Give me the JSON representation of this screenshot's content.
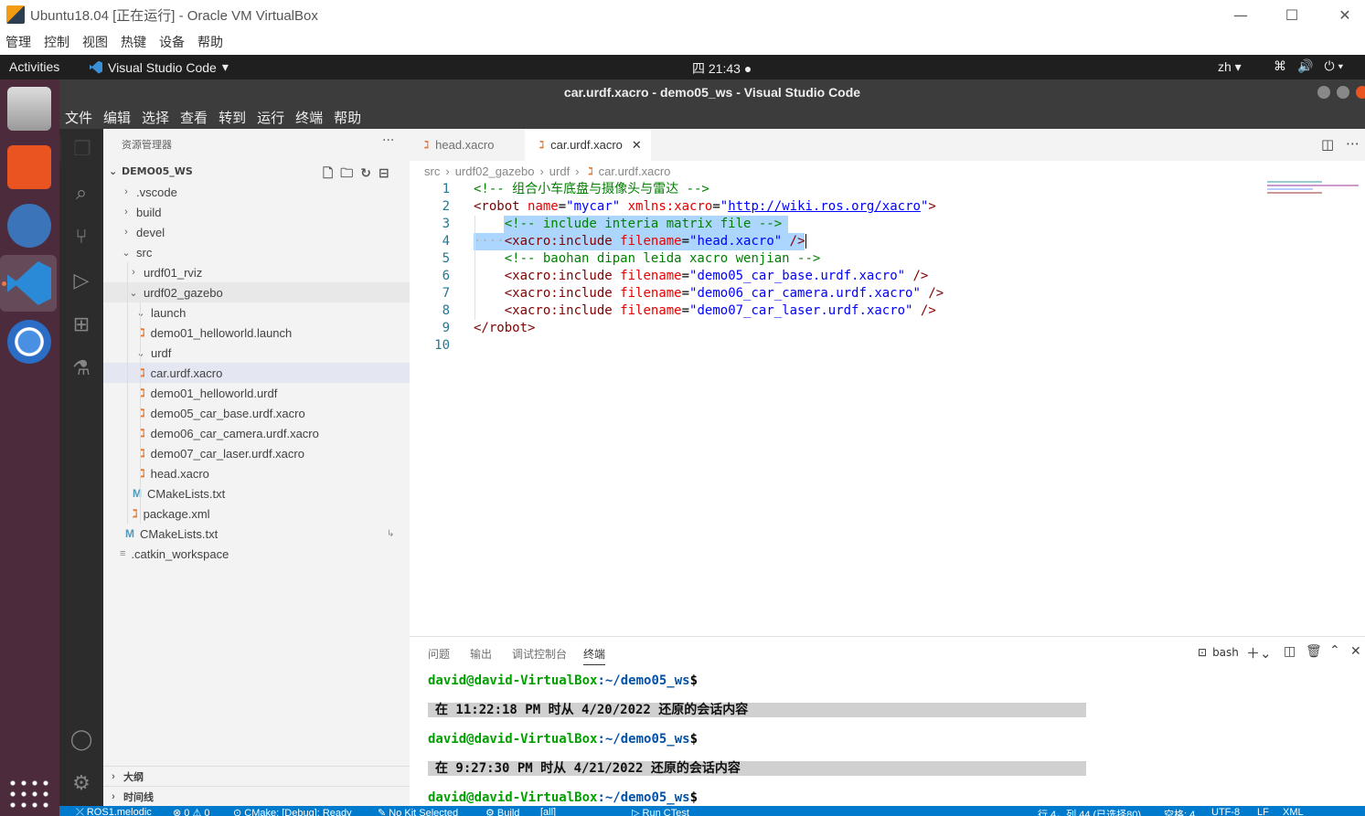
{
  "vbox": {
    "title": "Ubuntu18.04 [正在运行] - Oracle VM VirtualBox",
    "menu": [
      "管理",
      "控制",
      "视图",
      "热键",
      "设备",
      "帮助"
    ],
    "controls": {
      "minimize": "—",
      "maximize": "☐",
      "close": "✕"
    }
  },
  "ubuntu": {
    "activities": "Activities",
    "app_name": "Visual Studio Code",
    "app_arrow": "▾",
    "clock": "四 21:43 ●",
    "lang": "zh ▾",
    "tray": [
      "⌘",
      "🔊",
      "⏻ ▾"
    ]
  },
  "vscode": {
    "title": "car.urdf.xacro - demo05_ws - Visual Studio Code",
    "menu": [
      "文件",
      "编辑",
      "选择",
      "查看",
      "转到",
      "运行",
      "终端",
      "帮助"
    ],
    "explorer_title": "资源管理器",
    "explorer_dots": "···",
    "workspace": "DEMO05_WS",
    "tree": [
      {
        "label": ".vscode",
        "chev": "›",
        "icon": ""
      },
      {
        "label": "build",
        "chev": "›",
        "icon": ""
      },
      {
        "label": "devel",
        "chev": "›",
        "icon": ""
      },
      {
        "label": "src",
        "chev": "⌄",
        "icon": ""
      },
      {
        "label": "urdf01_rviz",
        "chev": "›",
        "icon": ""
      },
      {
        "label": "urdf02_gazebo",
        "chev": "⌄",
        "icon": ""
      },
      {
        "label": "launch",
        "chev": "⌄",
        "icon": ""
      },
      {
        "label": "demo01_helloworld.launch",
        "chev": "",
        "icon": "x"
      },
      {
        "label": "urdf",
        "chev": "⌄",
        "icon": ""
      },
      {
        "label": "car.urdf.xacro",
        "chev": "",
        "icon": "x"
      },
      {
        "label": "demo01_helloworld.urdf",
        "chev": "",
        "icon": "x"
      },
      {
        "label": "demo05_car_base.urdf.xacro",
        "chev": "",
        "icon": "x"
      },
      {
        "label": "demo06_car_camera.urdf.xacro",
        "chev": "",
        "icon": "x"
      },
      {
        "label": "demo07_car_laser.urdf.xacro",
        "chev": "",
        "icon": "x"
      },
      {
        "label": "head.xacro",
        "chev": "",
        "icon": "x"
      },
      {
        "label": "CMakeLists.txt",
        "chev": "",
        "icon": "M"
      },
      {
        "label": "package.xml",
        "chev": "",
        "icon": "x"
      },
      {
        "label": "CMakeLists.txt",
        "chev": "",
        "icon": "M"
      },
      {
        "label": ".catkin_workspace",
        "chev": "",
        "icon": "≡"
      }
    ],
    "outline": "大纲",
    "timeline": "时间线",
    "tabs": [
      {
        "label": "head.xacro"
      },
      {
        "label": "car.urdf.xacro",
        "close": "✕"
      }
    ],
    "breadcrumb": [
      "src",
      "urdf02_gazebo",
      "urdf",
      "car.urdf.xacro"
    ],
    "breadcrumb_sep": "›",
    "line_numbers": [
      "1",
      "2",
      "3",
      "4",
      "5",
      "6",
      "7",
      "8",
      "9",
      "10"
    ],
    "code": {
      "l1": "<!-- 组合小车底盘与摄像头与雷达 -->",
      "l2_tag": "<robot",
      "l2_attr1": "name",
      "l2_val1": "\"mycar\"",
      "l2_attr2": "xmlns:xacro",
      "l2_val2": "http://wiki.ros.org/xacro",
      "l3": "<!-- include interia matrix file -->",
      "l4_tag": "<xacro:include",
      "l4_attr": "filename",
      "l4_val": "\"head.xacro\"",
      "l4_end": "/>",
      "l5": "<!-- baohan dipan leida xacro wenjian -->",
      "l6_val": "\"demo05_car_base.urdf.xacro\"",
      "l7_val": "\"demo06_car_camera.urdf.xacro\"",
      "l8_val": "\"demo07_car_laser.urdf.xacro\"",
      "l9": "</robot>"
    },
    "panel_tabs": [
      "问题",
      "输出",
      "调试控制台",
      "终端"
    ],
    "terminal_shell": "bash",
    "terminal": {
      "user": "david@david-VirtualBox",
      "path": ":~/demo05_ws",
      "dollar": "$",
      "restore1": "在 11:22:18 PM 时从 4/20/2022 还原的会话内容",
      "restore2": "在 9:27:30 PM 时从 4/21/2022 还原的会话内容"
    },
    "status": {
      "ros": "⤫ ROS1.melodic",
      "problems": "⊗ 0 ⚠ 0",
      "cmake": "⊙ CMake: [Debug]: Ready",
      "kit": "✎ No Kit Selected",
      "build": "⚙ Build",
      "all": "[all]",
      "ctest": "▷ Run CTest",
      "pos": "行 4，列 44 (已选择80)",
      "spaces": "空格: 4",
      "enc": "UTF-8",
      "eol": "LF",
      "lang": "XML"
    }
  }
}
